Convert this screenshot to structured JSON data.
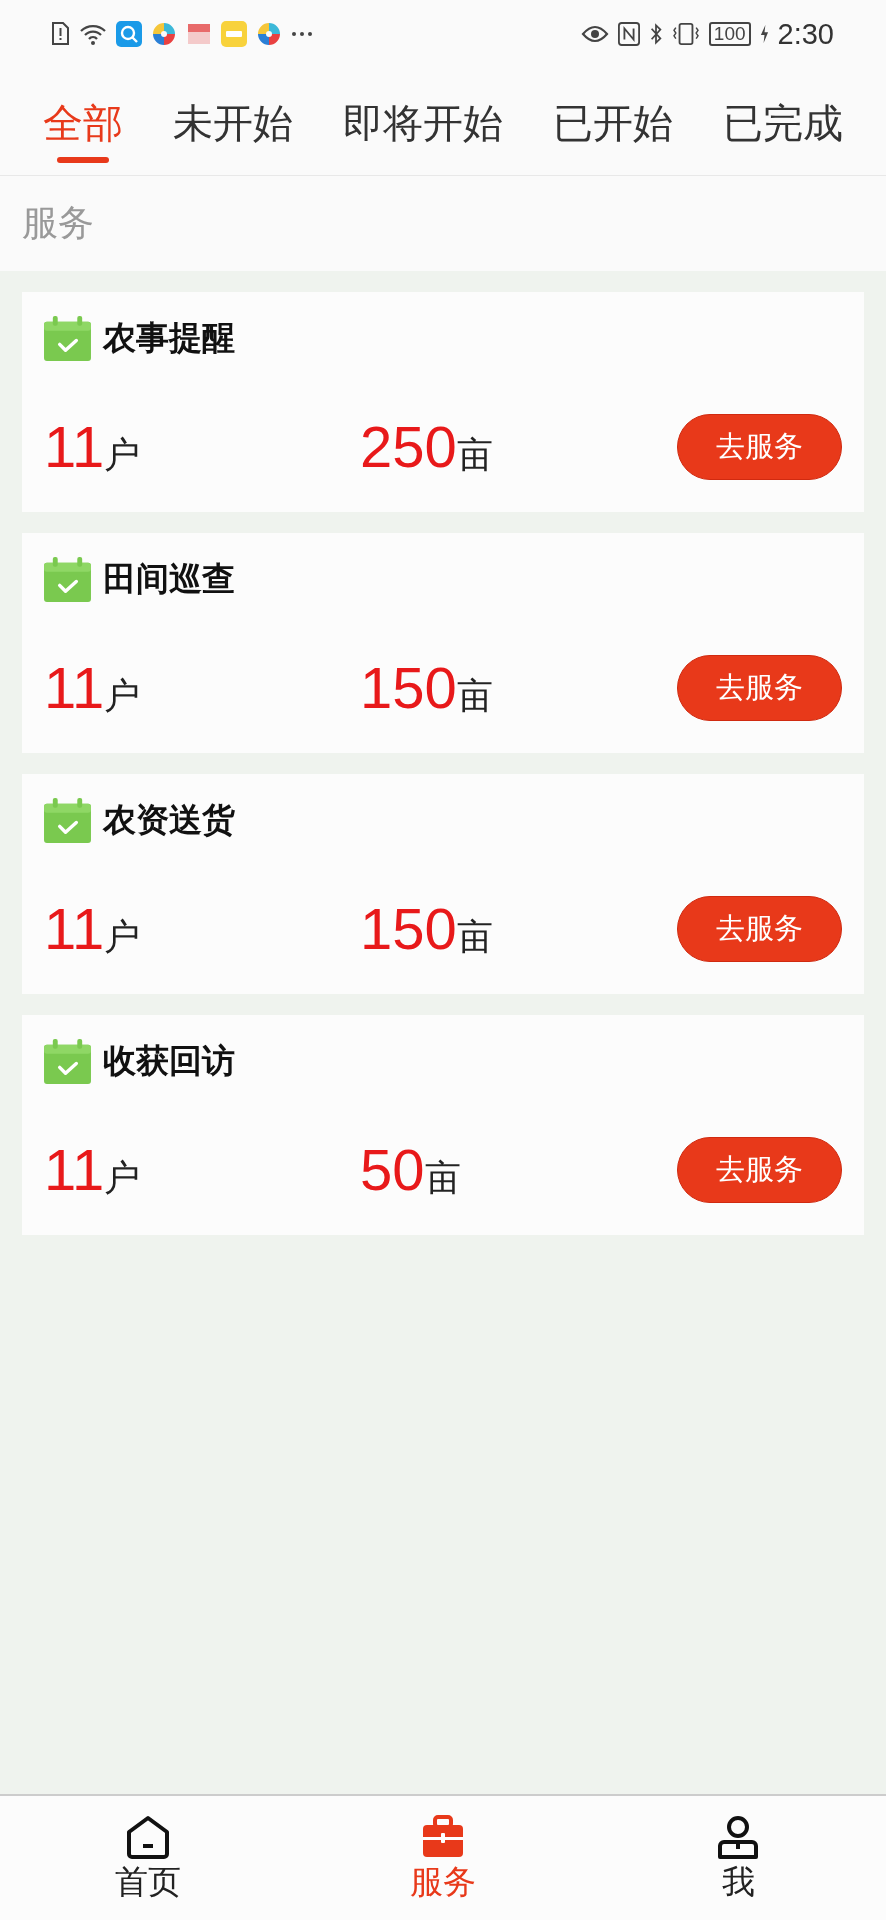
{
  "status_bar": {
    "battery": "100",
    "time": "2:30"
  },
  "tabs": [
    {
      "label": "全部",
      "selected": true
    },
    {
      "label": "未开始",
      "selected": false
    },
    {
      "label": "即将开始",
      "selected": false
    },
    {
      "label": "已开始",
      "selected": false
    },
    {
      "label": "已完成",
      "selected": false
    }
  ],
  "section_title": "服务",
  "cards": [
    {
      "title": "农事提醒",
      "households": "11",
      "households_unit": "户",
      "area": "250",
      "area_unit": "亩",
      "button": "去服务"
    },
    {
      "title": "田间巡查",
      "households": "11",
      "households_unit": "户",
      "area": "150",
      "area_unit": "亩",
      "button": "去服务"
    },
    {
      "title": "农资送货",
      "households": "11",
      "households_unit": "户",
      "area": "150",
      "area_unit": "亩",
      "button": "去服务"
    },
    {
      "title": "收获回访",
      "households": "11",
      "households_unit": "户",
      "area": "50",
      "area_unit": "亩",
      "button": "去服务"
    }
  ],
  "bottom_nav": [
    {
      "kind": "home",
      "label": "首页",
      "selected": false
    },
    {
      "kind": "service",
      "label": "服务",
      "selected": true
    },
    {
      "kind": "me",
      "label": "我",
      "selected": false
    }
  ]
}
